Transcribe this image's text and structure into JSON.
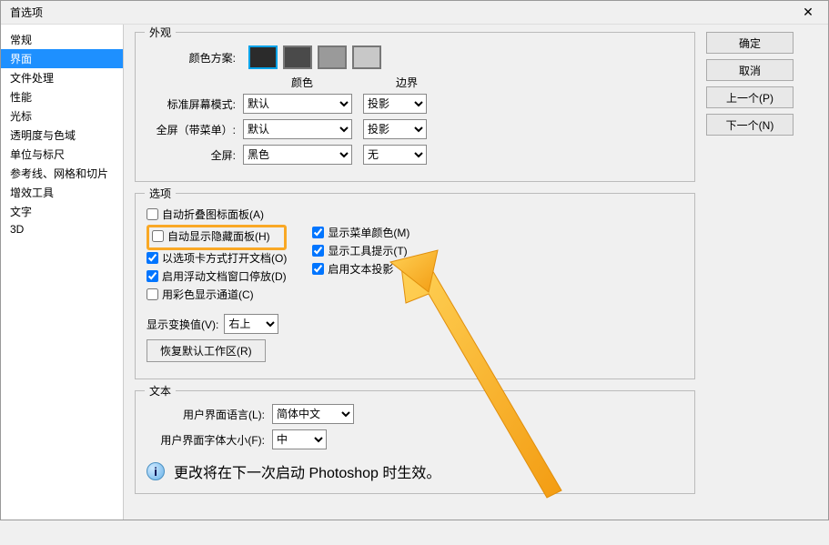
{
  "window": {
    "title": "首选项"
  },
  "sidebar": {
    "items": [
      {
        "label": "常规"
      },
      {
        "label": "界面"
      },
      {
        "label": "文件处理"
      },
      {
        "label": "性能"
      },
      {
        "label": "光标"
      },
      {
        "label": "透明度与色域"
      },
      {
        "label": "单位与标尺"
      },
      {
        "label": "参考线、网格和切片"
      },
      {
        "label": "增效工具"
      },
      {
        "label": "文字"
      },
      {
        "label": "3D"
      }
    ],
    "selected_index": 1
  },
  "buttons": {
    "ok": "确定",
    "cancel": "取消",
    "prev": "上一个(P)",
    "next": "下一个(N)"
  },
  "appearance": {
    "group_title": "外观",
    "color_scheme_label": "颜色方案:",
    "swatches": [
      "#2b2b2b",
      "#4a4a4a",
      "#9a9a9a",
      "#c8c8c8"
    ],
    "selected_swatch": 0,
    "header_color": "颜色",
    "header_boundary": "边界",
    "rows": [
      {
        "label": "标准屏幕模式:",
        "color": "默认",
        "boundary": "投影"
      },
      {
        "label": "全屏（带菜单）:",
        "color": "默认",
        "boundary": "投影"
      },
      {
        "label": "全屏:",
        "color": "黑色",
        "boundary": "无"
      }
    ]
  },
  "options": {
    "group_title": "选项",
    "left": [
      {
        "label": "自动折叠图标面板(A)",
        "checked": false
      },
      {
        "label": "自动显示隐藏面板(H)",
        "checked": false,
        "highlight": true
      },
      {
        "label": "以选项卡方式打开文档(O)",
        "checked": true
      },
      {
        "label": "启用浮动文档窗口停放(D)",
        "checked": true
      },
      {
        "label": "用彩色显示通道(C)",
        "checked": false
      }
    ],
    "right": [
      {
        "label": "显示菜单颜色(M)",
        "checked": true
      },
      {
        "label": "显示工具提示(T)",
        "checked": true
      },
      {
        "label": "启用文本投影",
        "checked": true
      }
    ],
    "show_transform_label": "显示变换值(V):",
    "show_transform_value": "右上",
    "restore_button": "恢复默认工作区(R)"
  },
  "text": {
    "group_title": "文本",
    "ui_language_label": "用户界面语言(L):",
    "ui_language_value": "简体中文",
    "ui_font_label": "用户界面字体大小(F):",
    "ui_font_value": "中",
    "info": "更改将在下一次启动 Photoshop 时生效。"
  }
}
